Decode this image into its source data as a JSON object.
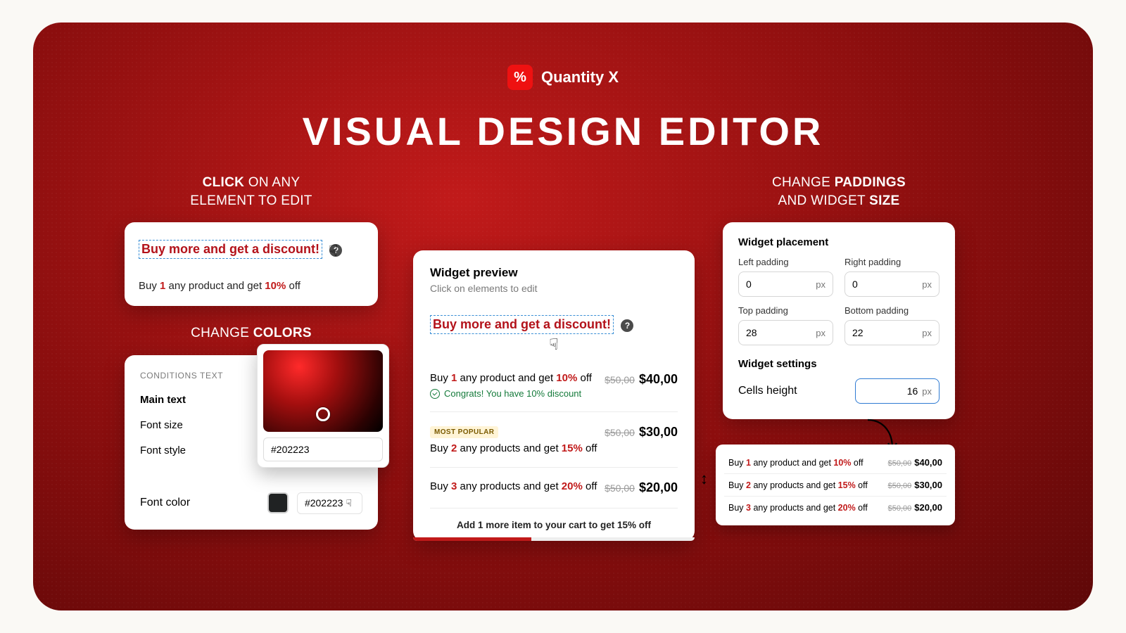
{
  "brand": {
    "name": "Quantity X",
    "logo_glyph": "%"
  },
  "hero": "VISUAL DESIGN EDITOR",
  "headers": {
    "click": {
      "l1a": "CLICK",
      "l1b": " ON ANY",
      "l2": "ELEMENT TO EDIT"
    },
    "colors": {
      "a": "CHANGE ",
      "b": "COLORS"
    },
    "paddings": {
      "l1a": "CHANGE ",
      "l1b": "PADDINGS",
      "l2a": "AND WIDGET ",
      "l2b": "SIZE"
    }
  },
  "click_card": {
    "promo_text": "Buy more and get a discount!",
    "help": "?",
    "offer": {
      "pre": "Buy ",
      "q": "1",
      "mid": " any product and get ",
      "pct": "10%",
      "post": " off"
    }
  },
  "colors_card": {
    "section_label": "CONDITIONS TEXT",
    "rows": {
      "main_text": "Main text",
      "font_size": "Font size",
      "font_style": "Font style",
      "font_color": "Font color"
    },
    "hex": "#202223",
    "hex_chip": "#202223"
  },
  "preview": {
    "title": "Widget preview",
    "subtitle": "Click on elements to edit",
    "promo_text": "Buy more and get a discount!",
    "help": "?",
    "tiers": [
      {
        "q": "1",
        "mid": " any product and get ",
        "pct": "10%",
        "congrats": "Congrats! You have 10% discount",
        "old": "$50,00",
        "new": "$40,00",
        "badge": null
      },
      {
        "q": "2",
        "mid": " any products and get ",
        "pct": "15%",
        "congrats": null,
        "old": "$50,00",
        "new": "$30,00",
        "badge": "MOST POPULAR"
      },
      {
        "q": "3",
        "mid": " any products and get ",
        "pct": "20%",
        "congrats": null,
        "old": "$50,00",
        "new": "$20,00",
        "badge": null
      }
    ],
    "progress_label": "Add 1 more item to your cart to get 15% off",
    "buy_word": "Buy ",
    "off_word": " off"
  },
  "paddings": {
    "placement_title": "Widget placement",
    "settings_title": "Widget settings",
    "unit": "px",
    "left": {
      "label": "Left padding",
      "value": "0"
    },
    "right": {
      "label": "Right padding",
      "value": "0"
    },
    "top": {
      "label": "Top padding",
      "value": "28"
    },
    "bottom": {
      "label": "Bottom padding",
      "value": "22"
    },
    "cells": {
      "label": "Cells height",
      "value": "16"
    }
  },
  "mini": {
    "rows": [
      {
        "q": "1",
        "mid": " any product and get ",
        "pct": "10%",
        "old": "$50,00",
        "new": "$40,00"
      },
      {
        "q": "2",
        "mid": " any products and get ",
        "pct": "15%",
        "old": "$50,00",
        "new": "$30,00"
      },
      {
        "q": "3",
        "mid": " any products and get ",
        "pct": "20%",
        "old": "$50,00",
        "new": "$20,00"
      }
    ],
    "buy_word": "Buy ",
    "off_word": " off"
  },
  "icons": {
    "doublearrow": "↕",
    "pointer": "☟"
  }
}
